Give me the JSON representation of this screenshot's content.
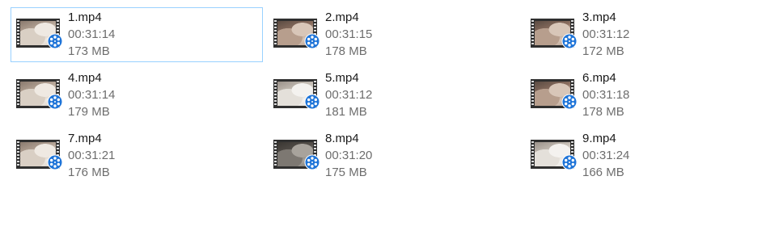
{
  "files": [
    {
      "name": "1.mp4",
      "duration": "00:31:14",
      "size": "173 MB",
      "selected": true,
      "scene": "light"
    },
    {
      "name": "2.mp4",
      "duration": "00:31:15",
      "size": "178 MB",
      "selected": false,
      "scene": "warm"
    },
    {
      "name": "3.mp4",
      "duration": "00:31:12",
      "size": "172 MB",
      "selected": false,
      "scene": "warm"
    },
    {
      "name": "4.mp4",
      "duration": "00:31:14",
      "size": "179 MB",
      "selected": false,
      "scene": "light"
    },
    {
      "name": "5.mp4",
      "duration": "00:31:12",
      "size": "181 MB",
      "selected": false,
      "scene": "pale"
    },
    {
      "name": "6.mp4",
      "duration": "00:31:18",
      "size": "178 MB",
      "selected": false,
      "scene": "warm"
    },
    {
      "name": "7.mp4",
      "duration": "00:31:21",
      "size": "176 MB",
      "selected": false,
      "scene": "light"
    },
    {
      "name": "8.mp4",
      "duration": "00:31:20",
      "size": "175 MB",
      "selected": false,
      "scene": "dark"
    },
    {
      "name": "9.mp4",
      "duration": "00:31:24",
      "size": "166 MB",
      "selected": false,
      "scene": "pale"
    }
  ],
  "icons": {
    "file_type": "video-file-icon",
    "badge": "film-reel-icon"
  },
  "colors": {
    "selection_border": "#99d1ff",
    "badge_blue": "#1e74d8",
    "name_text": "#1a1a1a",
    "meta_text": "#6d6d6d"
  }
}
